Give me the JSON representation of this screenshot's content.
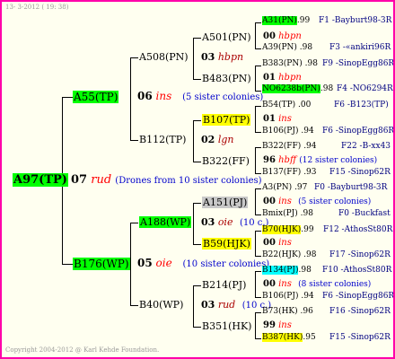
{
  "header": {
    "date": "13-  3-2012 ( 19: 38)"
  },
  "footer": {
    "copyright": "Copyright 2004-2012 @ Karl Kehde Foundation."
  },
  "root": {
    "label": "A97(TP)",
    "num": "07",
    "colony": "rud",
    "note": "(Drones from 10 sister colonies)"
  },
  "a55": {
    "label": "A55(TP)",
    "num": "06",
    "colony": "ins",
    "note": "(5 sister colonies)"
  },
  "b176": {
    "label": "B176(WP)",
    "num": "05",
    "colony": "oie",
    "note": "(10 sister colonies)"
  },
  "a508": {
    "label": "A508(PN)",
    "num": "03",
    "colony": "hbpn"
  },
  "b112": {
    "label": "B112(TP)",
    "num": "02",
    "colony": "lgn"
  },
  "a188": {
    "label": "A188(WP)",
    "num": "03",
    "colony": "oie",
    "note": "(10 c.)"
  },
  "b40": {
    "label": "B40(WP)",
    "num": "03",
    "colony": "rud",
    "note": "(10 c.)"
  },
  "a501": {
    "label": "A501(PN)",
    "num": "00",
    "colony": "hbpn"
  },
  "b483": {
    "label": "B483(PN)",
    "num": "01",
    "colony": "hbpn"
  },
  "b107": {
    "label": "B107(TP)",
    "num": "01",
    "colony": "ins"
  },
  "b322": {
    "label": "B322(FF)",
    "num": "96",
    "colony": "hbff",
    "note": "(12 sister colonies)"
  },
  "a151": {
    "label": "A151(PJ)",
    "num": "00",
    "colony": "ins",
    "note": "(5 sister colonies)"
  },
  "b59": {
    "label": "B59(HJK)",
    "num": "00",
    "colony": "ins"
  },
  "b214": {
    "label": "B214(PJ)",
    "num": "00",
    "colony": "ins",
    "note": "(8 sister colonies)"
  },
  "b351": {
    "label": "B351(HK)",
    "num": "99",
    "colony": "ins"
  },
  "leaves": [
    {
      "label": "A31(PN)",
      "val": ".99",
      "ref": "F1 -Bayburt98-3R"
    },
    {
      "label": "A39(PN)",
      "val": ".98",
      "ref": "F3 -«ankiri96R"
    },
    {
      "label": "B383(PN)",
      "val": ".98",
      "ref": "F9 -SinopEgg86R"
    },
    {
      "label": "NO6238b(PN)",
      "val": ".98",
      "ref": "F4 -NO6294R"
    },
    {
      "label": "B54(TP)",
      "val": ".00",
      "ref": "F6 -B123(TP)"
    },
    {
      "label": "B106(PJ)",
      "val": ".94",
      "ref": "F6 -SinopEgg86R"
    },
    {
      "label": "B322(FF)",
      "val": ".94",
      "ref": "F22 -B-xx43"
    },
    {
      "label": "B137(FF)",
      "val": ".93",
      "ref": "F15 -Sinop62R"
    },
    {
      "label": "A3(PN)",
      "val": ".97",
      "ref": "F0 -Bayburt98-3R"
    },
    {
      "label": "Bmix(PJ)",
      "val": ".98",
      "ref": "F0 -Buckfast"
    },
    {
      "label": "B70(HJK)",
      "val": ".99",
      "ref": "F12 -AthosSt80R"
    },
    {
      "label": "B22(HJK)",
      "val": ".98",
      "ref": "F17 -Sinop62R"
    },
    {
      "label": "B134(PJ)",
      "val": ".98",
      "ref": "F10 -AthosSt80R"
    },
    {
      "label": "B106(PJ)",
      "val": ".94",
      "ref": "F6 -SinopEgg86R"
    },
    {
      "label": "B73(HK)",
      "val": ".96",
      "ref": "F16 -Sinop62R"
    },
    {
      "label": "B387(HK)",
      "val": ".95",
      "ref": "F15 -Sinop62R"
    }
  ],
  "colors": {
    "border": "#ff00aa",
    "background": "#fffff0",
    "highlight_green": "#00ff00",
    "highlight_yellow": "#ffff00",
    "highlight_gray": "#c8c8c8",
    "highlight_cyan": "#00ffff"
  }
}
